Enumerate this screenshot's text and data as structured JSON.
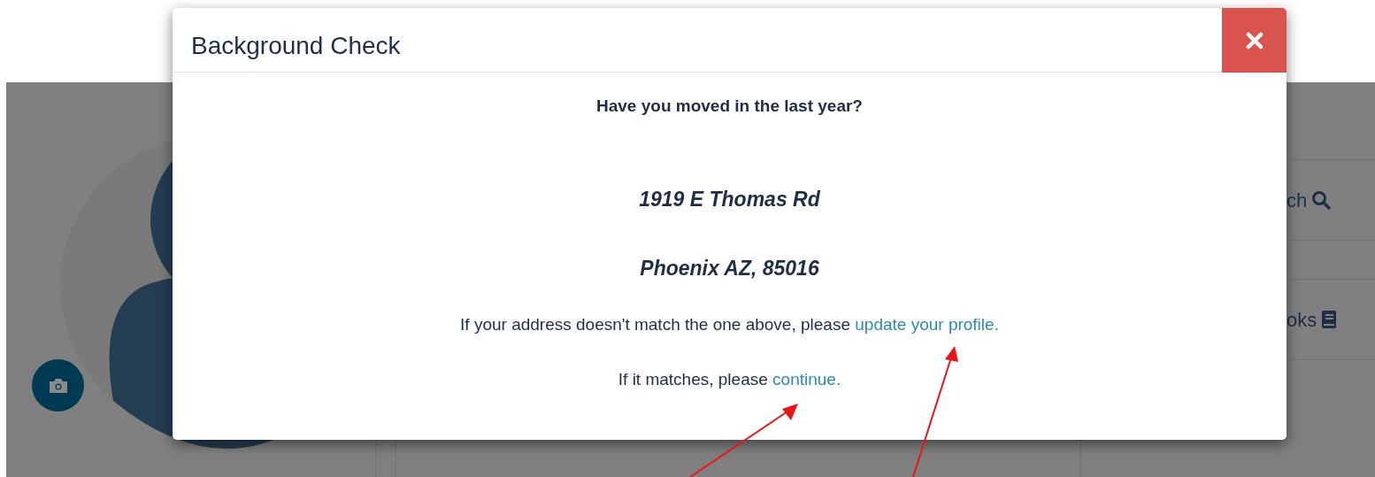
{
  "background": {
    "side_items": [
      {
        "label": "ch",
        "kind": "search"
      },
      {
        "label": "oks",
        "kind": "book"
      }
    ]
  },
  "dialog": {
    "title": "Background Check",
    "question": "Have you moved in the last year?",
    "address_lines": [
      "1919 E Thomas Rd",
      "Phoenix AZ, 85016"
    ],
    "messages": [
      {
        "text": "If your address doesn't match the one above, please ",
        "link": "update your profile."
      },
      {
        "text": "If it matches, please ",
        "link": "continue."
      }
    ]
  }
}
